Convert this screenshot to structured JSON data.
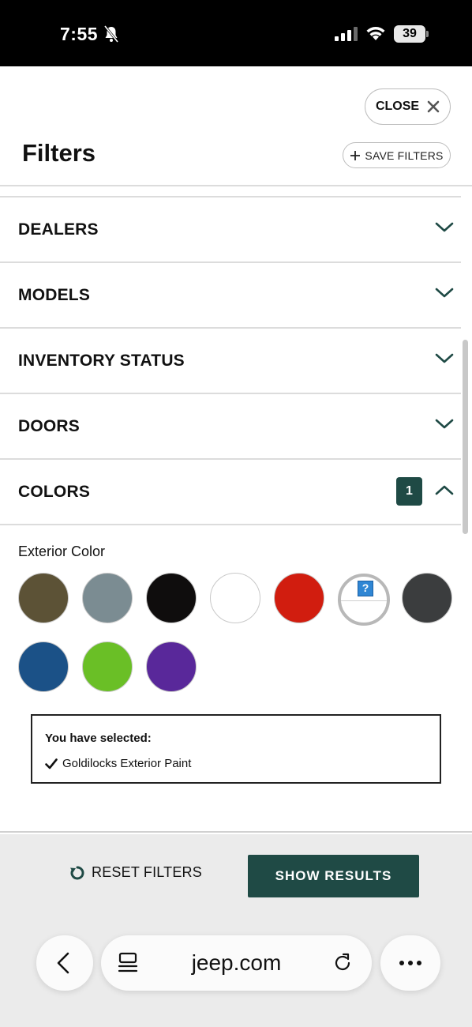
{
  "status_bar": {
    "time": "7:55",
    "battery": "39"
  },
  "header": {
    "close_label": "CLOSE",
    "title": "Filters",
    "save_label": "SAVE FILTERS"
  },
  "filters": {
    "sections": [
      {
        "label": "DEALERS"
      },
      {
        "label": "MODELS"
      },
      {
        "label": "INVENTORY STATUS"
      },
      {
        "label": "DOORS"
      },
      {
        "label": "COLORS",
        "count": "1"
      }
    ],
    "colors": {
      "label": "Exterior Color",
      "swatches": [
        {
          "color": "#5c5236"
        },
        {
          "color": "#7b8c92"
        },
        {
          "color": "#0f0d0d"
        },
        {
          "color": "#ffffff"
        },
        {
          "color": "#d11d0f"
        },
        {
          "color": "unknown",
          "selected": true
        },
        {
          "color": "#3b3d3e"
        },
        {
          "color": "#1b5187"
        },
        {
          "color": "#6abf26"
        },
        {
          "color": "#59289a"
        }
      ],
      "selected_title": "You have selected:",
      "selected_item": "Goldilocks Exterior Paint"
    }
  },
  "footer": {
    "reset_label": "RESET FILTERS",
    "show_label": "SHOW RESULTS"
  },
  "browser": {
    "url": "jeep.com"
  },
  "colors": {
    "brand_dark_green": "#1f4a45"
  }
}
